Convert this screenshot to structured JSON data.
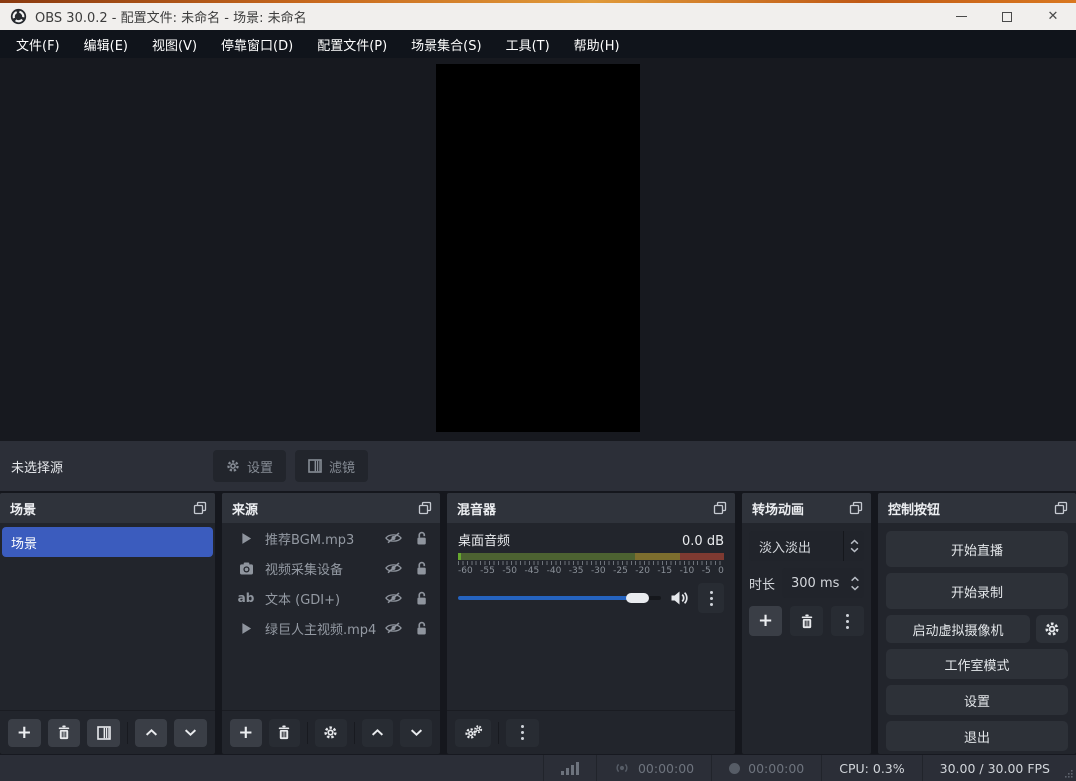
{
  "titlebar": {
    "title": "OBS 30.0.2 - 配置文件: 未命名 - 场景: 未命名"
  },
  "menu": {
    "items": [
      "文件(F)",
      "编辑(E)",
      "视图(V)",
      "停靠窗口(D)",
      "配置文件(P)",
      "场景集合(S)",
      "工具(T)",
      "帮助(H)"
    ]
  },
  "selection_bar": {
    "label": "未选择源",
    "settings_label": "设置",
    "filters_label": "滤镜"
  },
  "panels": {
    "scenes": {
      "title": "场景",
      "items": [
        {
          "name": "场景",
          "selected": true
        }
      ]
    },
    "sources": {
      "title": "来源",
      "items": [
        {
          "type": "media",
          "name": "推荐BGM.mp3",
          "visible": false,
          "locked": false
        },
        {
          "type": "camera",
          "name": "视频采集设备",
          "visible": false,
          "locked": false
        },
        {
          "type": "text",
          "name": "文本 (GDI+)",
          "visible": false,
          "locked": false
        },
        {
          "type": "media",
          "name": "绿巨人主视频.mp4",
          "visible": false,
          "locked": false
        }
      ]
    },
    "mixer": {
      "title": "混音器",
      "channel_name": "桌面音频",
      "level": "0.0 dB",
      "ticks": [
        "-60",
        "-55",
        "-50",
        "-45",
        "-40",
        "-35",
        "-30",
        "-25",
        "-20",
        "-15",
        "-10",
        "-5",
        "0"
      ]
    },
    "transitions": {
      "title": "转场动画",
      "current": "淡入淡出",
      "duration_label": "时长",
      "duration_value": "300 ms"
    },
    "controls": {
      "title": "控制按钮",
      "start_streaming": "开始直播",
      "start_recording": "开始录制",
      "virtual_camera": "启动虚拟摄像机",
      "studio_mode": "工作室模式",
      "settings": "设置",
      "exit": "退出"
    }
  },
  "statusbar": {
    "stream_time": "00:00:00",
    "record_time": "00:00:00",
    "cpu": "CPU: 0.3%",
    "fps": "30.00 / 30.00 FPS"
  },
  "icons": {
    "text_source": "ab",
    "plus": "+",
    "close": "✕"
  },
  "colors": {
    "selected_scene": "#3b5cbe",
    "volume_slider": "#2563bf",
    "meter_green": "#4c6231",
    "meter_yellow": "#7d6e2e",
    "meter_red": "#7e3a31",
    "titlebar_bg": "#f1efed",
    "panel_bg": "#22252c",
    "panel_header_bg": "#2f333b"
  }
}
